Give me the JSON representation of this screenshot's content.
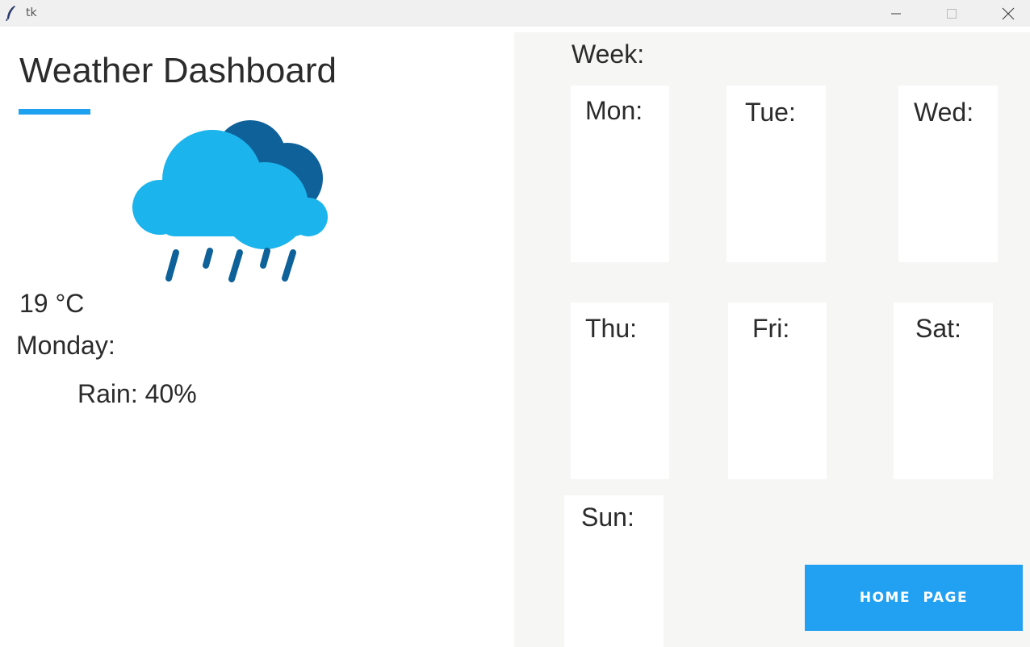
{
  "window": {
    "title": "tk",
    "app_icon": "feather-icon",
    "controls": [
      "minimize-icon",
      "maximize-icon",
      "close-icon"
    ]
  },
  "dashboard": {
    "title": "Weather Dashboard",
    "weather_icon": "rain-cloud-icon",
    "temperature": "19 °C",
    "day": "Monday:",
    "rain": "Rain: 40%"
  },
  "week": {
    "label": "Week:",
    "days": [
      "Mon:",
      "Tue:",
      "Wed:",
      "Thu:",
      "Fri:",
      "Sat:",
      "Sun:"
    ]
  },
  "home_button": {
    "label": "HOME PAGE"
  },
  "colors": {
    "accent": "#1ea1ef",
    "button": "#22a0f2",
    "cloud_front": "#1bb4ec",
    "cloud_back": "#0e6199",
    "panel_bg": "#f6f6f5"
  }
}
